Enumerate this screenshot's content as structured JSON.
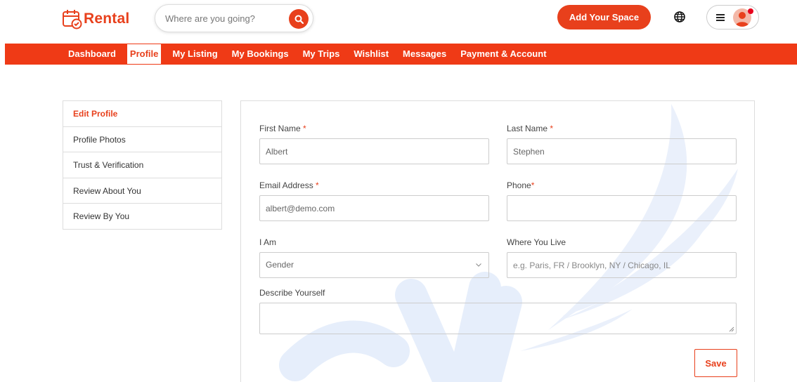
{
  "brand": {
    "name": "Rental",
    "accent_color": "#ef3a16",
    "logo_icon": "calendar-check-icon"
  },
  "search": {
    "placeholder": "Where are you going?",
    "icon": "search-icon"
  },
  "header": {
    "add_space_label": "Add Your Space",
    "language_icon": "globe-icon",
    "menu_icon": "hamburger-icon",
    "avatar_icon": "user-avatar-icon",
    "has_notification": true
  },
  "nav": {
    "items": [
      {
        "label": "Dashboard",
        "active": false
      },
      {
        "label": "Profile",
        "active": true
      },
      {
        "label": "My Listing",
        "active": false
      },
      {
        "label": "My Bookings",
        "active": false
      },
      {
        "label": "My Trips",
        "active": false
      },
      {
        "label": "Wishlist",
        "active": false
      },
      {
        "label": "Messages",
        "active": false
      },
      {
        "label": "Payment & Account",
        "active": false
      }
    ]
  },
  "sidebar": {
    "items": [
      {
        "label": "Edit Profile",
        "active": true
      },
      {
        "label": "Profile Photos",
        "active": false
      },
      {
        "label": "Trust & Verification",
        "active": false
      },
      {
        "label": "Review About You",
        "active": false
      },
      {
        "label": "Review By You",
        "active": false
      }
    ]
  },
  "form": {
    "first_name": {
      "label": "First Name",
      "required_mark": "*",
      "value": "Albert"
    },
    "last_name": {
      "label": "Last Name",
      "required_mark": "*",
      "value": "Stephen"
    },
    "email": {
      "label": "Email Address",
      "required_mark": "*",
      "value": "albert@demo.com"
    },
    "phone": {
      "label": "Phone",
      "required_mark": "*",
      "value": ""
    },
    "i_am": {
      "label": "I Am",
      "selected": "Gender"
    },
    "where_you_live": {
      "label": "Where You Live",
      "placeholder": "e.g. Paris, FR / Brooklyn, NY / Chicago, IL",
      "value": ""
    },
    "describe": {
      "label": "Describe Yourself",
      "value": ""
    },
    "save_label": "Save"
  }
}
